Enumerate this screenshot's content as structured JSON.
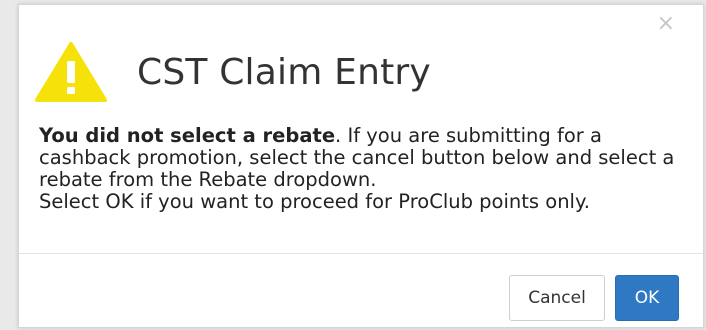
{
  "dialog": {
    "title": "CST Claim Entry",
    "close_glyph": "×",
    "icon": "warning-triangle-icon",
    "accent_color": "#f5e20a",
    "message": {
      "bold_lead": "You did not select a rebate",
      "line1_rest": ". If you are submitting for a cashback promotion, select the cancel button below and select a rebate from the Rebate dropdown.",
      "line2": "Select OK if you want to proceed for ProClub points only."
    },
    "buttons": {
      "cancel_label": "Cancel",
      "ok_label": "OK",
      "ok_color": "#2e78c4"
    }
  }
}
